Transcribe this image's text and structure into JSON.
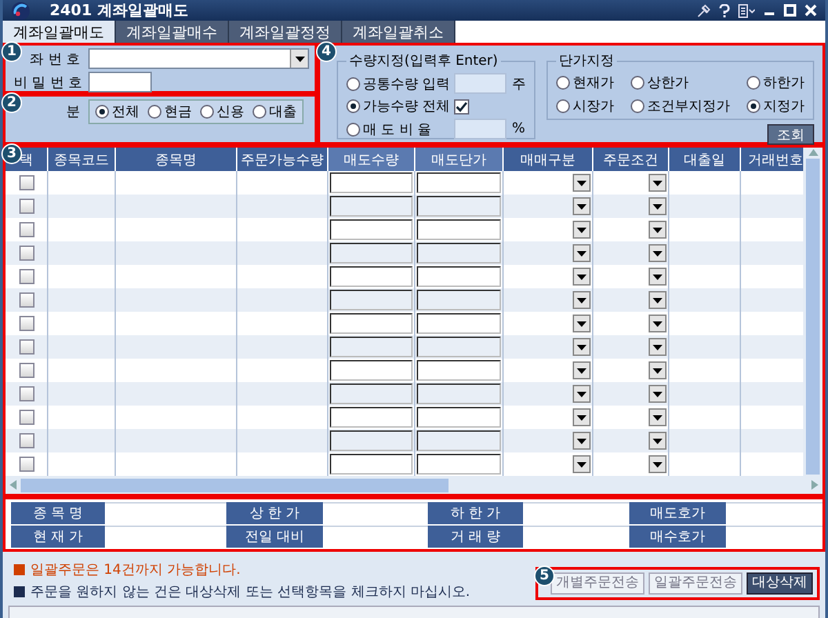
{
  "window": {
    "title": "2401 계좌일괄매도"
  },
  "tabs": [
    {
      "label": "계좌일괄매도",
      "selected": true
    },
    {
      "label": "계좌일괄매수",
      "selected": false
    },
    {
      "label": "계좌일괄정정",
      "selected": false
    },
    {
      "label": "계좌일괄취소",
      "selected": false
    }
  ],
  "account": {
    "badge": "1",
    "account_label": "좌 번 호",
    "password_label": "비 밀 번 호"
  },
  "category": {
    "badge": "2",
    "label": "분",
    "options": [
      {
        "label": "전체",
        "selected": true
      },
      {
        "label": "현금",
        "selected": false
      },
      {
        "label": "신용",
        "selected": false
      },
      {
        "label": "대출",
        "selected": false
      }
    ]
  },
  "quantity": {
    "badge": "4",
    "title": "수량지정(입력후 Enter)",
    "options": [
      {
        "kind": "input",
        "label": "공통수량 입력",
        "selected": false,
        "unit": "주"
      },
      {
        "kind": "checkbox",
        "label": "가능수량 전체",
        "selected": true,
        "checked": true
      },
      {
        "kind": "input",
        "label": "매 도 비 율",
        "selected": false,
        "unit": "%"
      }
    ]
  },
  "price": {
    "title": "단가지정",
    "options": [
      {
        "label": "현재가",
        "selected": false
      },
      {
        "label": "상한가",
        "selected": false
      },
      {
        "label": "하한가",
        "selected": false
      },
      {
        "label": "시장가",
        "selected": false
      },
      {
        "label": "조건부지정가",
        "selected": false
      },
      {
        "label": "지정가",
        "selected": true
      }
    ],
    "button": "조회"
  },
  "grid": {
    "badge": "3",
    "columns": [
      {
        "label": "택",
        "kind": "check"
      },
      {
        "label": "종목코드",
        "kind": "text"
      },
      {
        "label": "종목명",
        "kind": "text"
      },
      {
        "label": "주문가능수량",
        "kind": "text"
      },
      {
        "label": "매도수량",
        "kind": "input"
      },
      {
        "label": "매도단가",
        "kind": "input"
      },
      {
        "label": "매매구분",
        "kind": "select"
      },
      {
        "label": "주문조건",
        "kind": "select"
      },
      {
        "label": "대출일",
        "kind": "text"
      },
      {
        "label": "거래번호",
        "kind": "text"
      }
    ],
    "rows": [
      {
        "checked": false
      },
      {
        "checked": false
      },
      {
        "checked": false
      },
      {
        "checked": false
      },
      {
        "checked": false
      },
      {
        "checked": false
      },
      {
        "checked": false
      },
      {
        "checked": false
      },
      {
        "checked": false
      },
      {
        "checked": false
      },
      {
        "checked": false
      },
      {
        "checked": false
      },
      {
        "checked": false
      }
    ]
  },
  "info": {
    "labels": [
      "종 목 명",
      "상 한 가",
      "하 한 가",
      "매도호가",
      "현 재 가",
      "전일 대비",
      "거 래 량",
      "매수호가"
    ]
  },
  "notes": [
    {
      "kind": "warning",
      "text": "일괄주문은 14건까지 가능합니다."
    },
    {
      "kind": "info",
      "text": "주문을 원하지 않는 건은 대상삭제 또는 선택항목을 체크하지 마십시오."
    }
  ],
  "actions": {
    "badge": "5",
    "buttons": [
      {
        "label": "개별주문전송",
        "disabled": true
      },
      {
        "label": "일괄주문전송",
        "disabled": true
      },
      {
        "label": "대상삭제",
        "disabled": false
      }
    ]
  }
}
